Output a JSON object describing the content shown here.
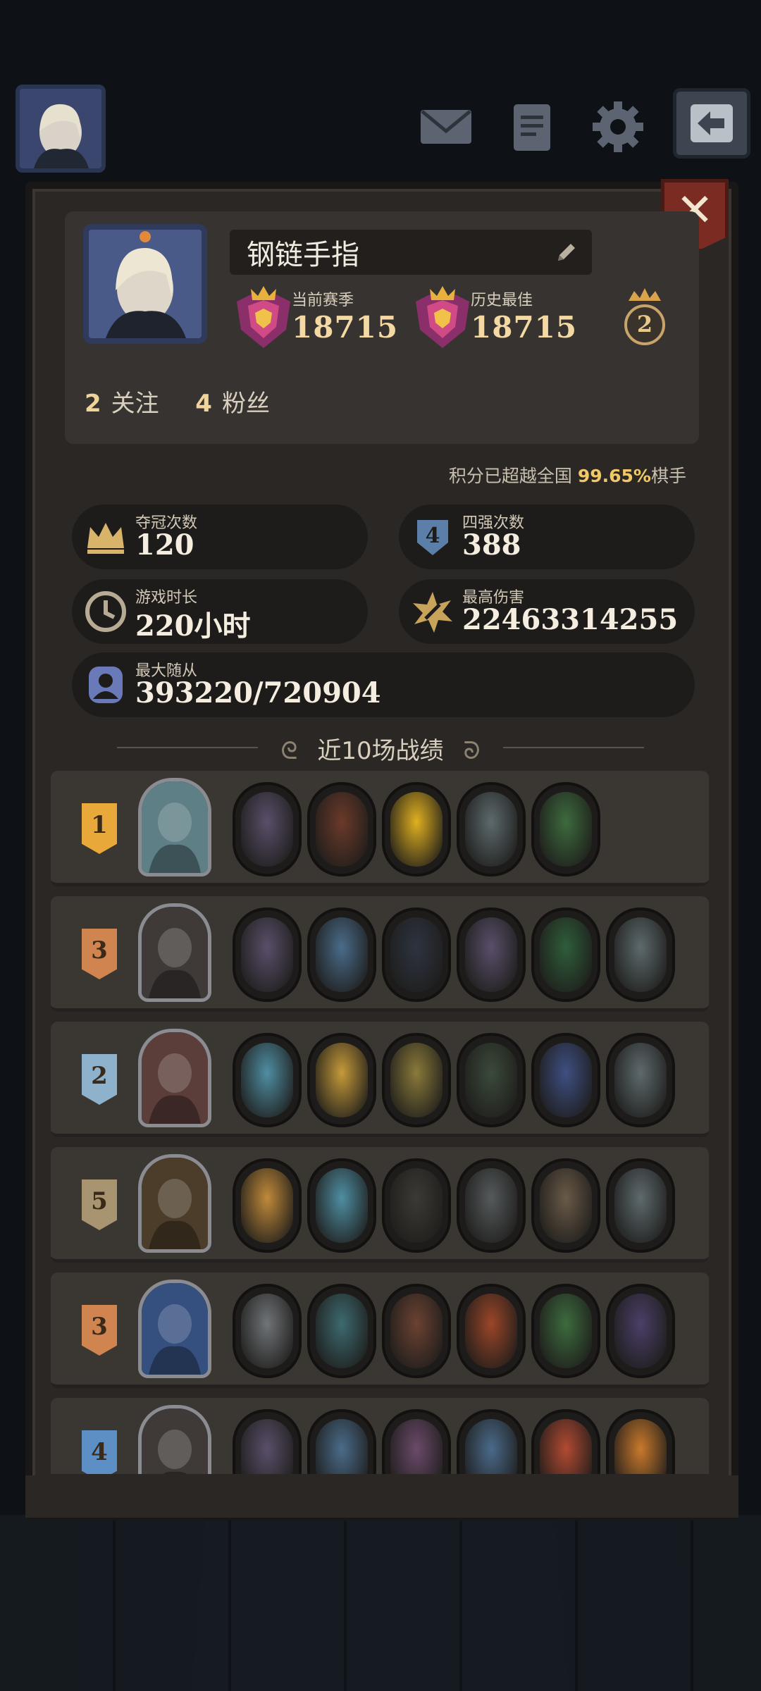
{
  "profile": {
    "name": "钢链手指",
    "current_season_label": "当前赛季",
    "current_season_score": "18715",
    "best_label": "历史最佳",
    "best_score": "18715",
    "rank_level": "2",
    "following_count": "2",
    "following_label": "关注",
    "fans_count": "4",
    "fans_label": "粉丝"
  },
  "beat_text": {
    "prefix": "积分已超越全国 ",
    "percent": "99.65%",
    "suffix": "棋手"
  },
  "stats": {
    "champion_label": "夺冠次数",
    "champion_value": "120",
    "top4_label": "四强次数",
    "top4_value": "388",
    "playtime_label": "游戏时长",
    "playtime_value": "220小时",
    "max_damage_label": "最高伤害",
    "max_damage_value": "22463314255",
    "max_followers_label": "最大随从",
    "max_followers_value": "393220/720904"
  },
  "section_title": "近10场战绩",
  "matches": [
    {
      "rank": "1",
      "badge_color": "#e8a93a",
      "hero_color": "#5f7f86",
      "units": [
        "#5a4f6a",
        "#6b3a2a",
        "#e0b020",
        "#5d6a6d",
        "#3d6b3e"
      ]
    },
    {
      "rank": "3",
      "badge_color": "#d0844f",
      "hero_color": "#3f3a38",
      "units": [
        "#5a4f6a",
        "#4a6c8a",
        "#2d3440",
        "#5a4f6a",
        "#2f5d3a",
        "#5d6a6d"
      ]
    },
    {
      "rank": "2",
      "badge_color": "#8fb2cc",
      "hero_color": "#5b3d3a",
      "units": [
        "#4f8ea2",
        "#c59a3a",
        "#8a7a3a",
        "#3b4a3a",
        "#3e4f82",
        "#5e6a6e"
      ]
    },
    {
      "rank": "5",
      "badge_color": "#a89470",
      "hero_color": "#4c3d2a",
      "units": [
        "#c08a3a",
        "#4f8ea2",
        "#3b3a35",
        "#555a5c",
        "#6a5a48",
        "#5e6a6e"
      ]
    },
    {
      "rank": "3",
      "badge_color": "#d0844f",
      "hero_color": "#35507e",
      "units": [
        "#707478",
        "#3d6a70",
        "#6b4232",
        "#9b4628",
        "#3d6b3e",
        "#4b3f68"
      ]
    },
    {
      "rank": "4",
      "badge_color": "#5d8fc4",
      "hero_color": "#3f3a38",
      "units": [
        "#5a4f6a",
        "#4a6c8a",
        "#6b4a6a",
        "#4a6a8a",
        "#b24a32",
        "#c9792c"
      ]
    }
  ],
  "icons": {
    "mail": "envelope-icon",
    "notes": "clipboard-icon",
    "settings": "gear-icon",
    "back": "back-arrow-icon",
    "close": "close-icon",
    "edit": "pencil-icon"
  }
}
